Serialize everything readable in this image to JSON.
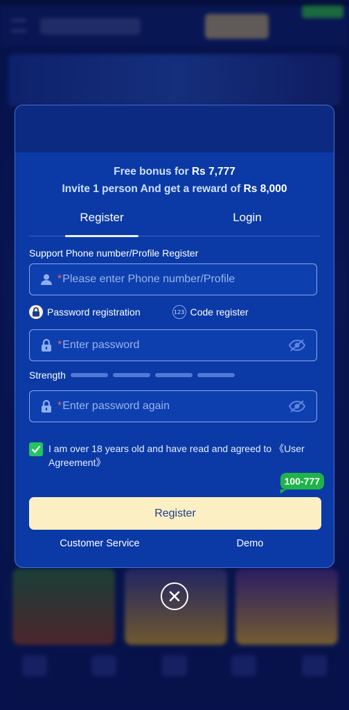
{
  "promo": {
    "line1_prefix": "Free bonus for ",
    "line1_amount": "Rs 7,777",
    "line2_prefix": "Invite 1 person And get a reward of ",
    "line2_amount": "Rs 8,000"
  },
  "tabs": [
    {
      "label": "Register",
      "active": true
    },
    {
      "label": "Login",
      "active": false
    }
  ],
  "form": {
    "support_label": "Support Phone number/Profile Register",
    "phone_placeholder": "Please enter Phone number/Profile",
    "required_mark": "*",
    "reg_options": [
      {
        "label": "Password registration",
        "icon": "lock-icon",
        "active": true
      },
      {
        "label": "Code register",
        "icon_text": "123",
        "active": false
      }
    ],
    "password_placeholder": "Enter password",
    "strength_label": "Strength",
    "strength_level": 0,
    "confirm_placeholder": "Enter password again",
    "agree_text": "I am over 18 years old and have read and agreed to ",
    "agree_link": "《User Agreement》",
    "agree_checked": true
  },
  "promo_bubble": "100-777",
  "register_button": "Register",
  "footer": {
    "customer_service": "Customer Service",
    "demo": "Demo"
  },
  "colors": {
    "modal_bg": "#0b3aa6",
    "button_bg": "#fcefc3",
    "check_green": "#22c55e"
  }
}
